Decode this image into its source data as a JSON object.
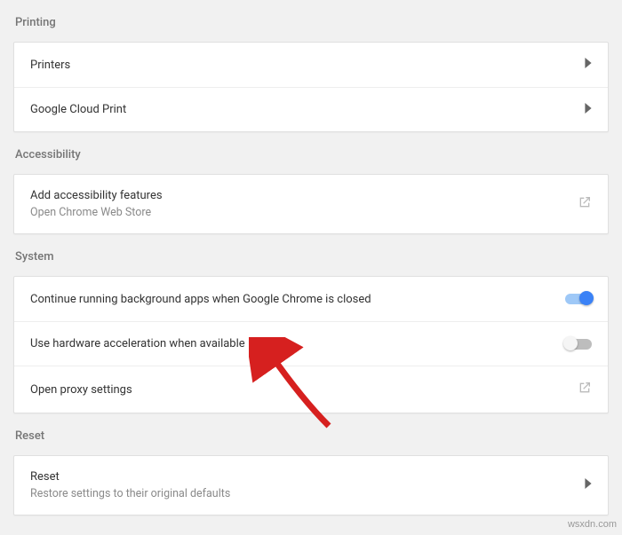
{
  "sections": {
    "printing": {
      "header": "Printing",
      "printers": "Printers",
      "cloud_print": "Google Cloud Print"
    },
    "accessibility": {
      "header": "Accessibility",
      "add_title": "Add accessibility features",
      "add_sub": "Open Chrome Web Store"
    },
    "system": {
      "header": "System",
      "bg_apps": "Continue running background apps when Google Chrome is closed",
      "hw_accel": "Use hardware acceleration when available",
      "proxy": "Open proxy settings"
    },
    "reset": {
      "header": "Reset",
      "title": "Reset",
      "sub": "Restore settings to their original defaults"
    }
  },
  "toggles": {
    "bg_apps": true,
    "hw_accel": false
  },
  "watermark": "wsxdn.com"
}
